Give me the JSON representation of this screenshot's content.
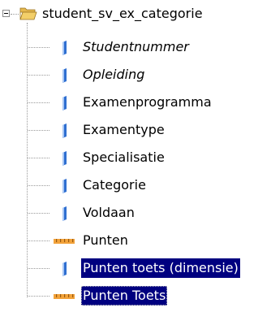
{
  "tree": {
    "root": {
      "label": "student_sv_ex_categorie",
      "expanded": true,
      "icon": "folder-open-icon"
    },
    "items": [
      {
        "label": "Studentnummer",
        "icon": "dimension-attribute-icon",
        "italic": true,
        "selected": false
      },
      {
        "label": "Opleiding",
        "icon": "dimension-attribute-icon",
        "italic": true,
        "selected": false
      },
      {
        "label": "Examenprogramma",
        "icon": "dimension-attribute-icon",
        "italic": false,
        "selected": false
      },
      {
        "label": "Examentype",
        "icon": "dimension-attribute-icon",
        "italic": false,
        "selected": false
      },
      {
        "label": "Specialisatie",
        "icon": "dimension-attribute-icon",
        "italic": false,
        "selected": false
      },
      {
        "label": "Categorie",
        "icon": "dimension-attribute-icon",
        "italic": false,
        "selected": false
      },
      {
        "label": "Voldaan",
        "icon": "dimension-attribute-icon",
        "italic": false,
        "selected": false
      },
      {
        "label": "Punten",
        "icon": "measure-icon",
        "italic": false,
        "selected": false
      },
      {
        "label": "Punten toets (dimensie)",
        "icon": "dimension-attribute-icon",
        "italic": false,
        "selected": true
      },
      {
        "label": "Punten Toets",
        "icon": "measure-icon",
        "italic": false,
        "selected": true
      }
    ]
  },
  "colors": {
    "selection_background": "#000080",
    "selection_text": "#ffffff",
    "dimension_icon": "#2f6fd1",
    "measure_icon": "#f2a23a",
    "folder": "#f3cf69"
  }
}
